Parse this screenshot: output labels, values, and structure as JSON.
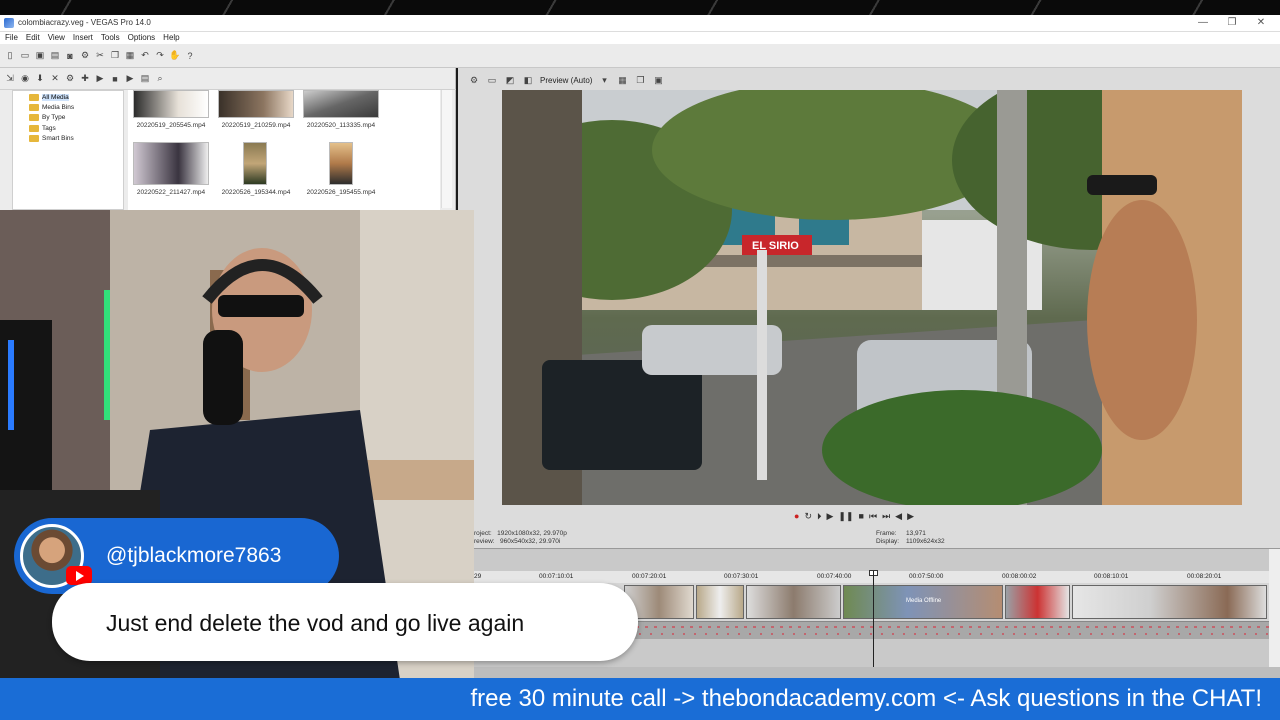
{
  "window": {
    "title": "colombiacrazy.veg - VEGAS Pro 14.0",
    "controls": [
      "—",
      "❐",
      "✕"
    ]
  },
  "menu": [
    "File",
    "Edit",
    "View",
    "Insert",
    "Tools",
    "Options",
    "Help"
  ],
  "media_tree": {
    "items": [
      {
        "label": "All Media",
        "selected": true
      },
      {
        "label": "Media Bins"
      },
      {
        "label": "By Type",
        "expandable": true
      },
      {
        "label": "Tags"
      },
      {
        "label": "Smart Bins"
      }
    ]
  },
  "media_files": [
    "20220519_205545.mp4",
    "20220519_210259.mp4",
    "20220520_113335.mp4",
    "20220522_211427.mp4",
    "20220526_195344.mp4",
    "20220526_195455.mp4"
  ],
  "preview": {
    "mode": "Preview (Auto)",
    "sign_text": "EL SIRIO",
    "project_line": "roject:   1920x1080x32, 29.970p",
    "preview_line": "review:   960x540x32, 29.970i",
    "frame_label": "Frame:",
    "frame_value": "13,971",
    "display_label": "Display:",
    "display_value": "1109x624x32"
  },
  "timeline": {
    "timecodes": [
      "29",
      "00:07:10:01",
      "00:07:20:01",
      "00:07:30:01",
      "00:07:40:00",
      "00:07:50:00",
      "00:08:00:02",
      "00:08:10:01",
      "00:08:20:01"
    ],
    "offline_clip_label": "Media Offline"
  },
  "chat": {
    "username": "@tjblackmore7863",
    "message": "Just end delete the vod and go live again",
    "platform_icon": "youtube-icon"
  },
  "banner": {
    "text": "free 30 minute call -> thebondacademy.com <- Ask questions in the CHAT!"
  },
  "colors": {
    "banner": "#1a6dd6",
    "chat_name_bubble": "#1967d2",
    "youtube_red": "#ff0000"
  }
}
